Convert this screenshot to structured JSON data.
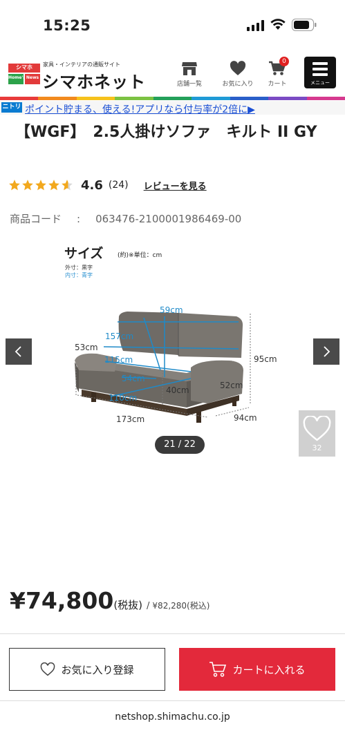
{
  "status": {
    "time": "15:25"
  },
  "header": {
    "logo_blocks": [
      "シマホ",
      "Home's",
      "News"
    ],
    "logo_tagline": "家具・インテリアの通販サイト",
    "logo_name": "シマホネット",
    "nav": [
      {
        "label": "店舗一覧",
        "icon": "store-icon"
      },
      {
        "label": "お気に入り",
        "icon": "heart-icon"
      },
      {
        "label": "カート",
        "icon": "cart-icon",
        "badge": "0"
      }
    ],
    "menu_label": "メニュー"
  },
  "colors": {
    "rainbow": [
      "#e83b3b",
      "#f28a1e",
      "#f6c21c",
      "#7cc242",
      "#24a05a",
      "#1f9ad6",
      "#2a5fc9",
      "#7b4bc4",
      "#d63a8f"
    ],
    "accent": "#e3293b",
    "link": "#1a4fd4",
    "dimension_blue": "#1f8ac8"
  },
  "promo": {
    "badge": "ニトリ",
    "text": "ポイント貯まる、使える!アプリなら付与率が2倍に▶"
  },
  "product": {
    "title": "【WGF】　2.5人掛けソファ　キルト II GY",
    "rating": {
      "score": "4.6",
      "count": "(24)",
      "stars": 4.6,
      "review_link": "レビューを見る"
    },
    "code_label": "商品コード",
    "code_sep": ":",
    "code_value": "063476-2100001986469-00"
  },
  "image": {
    "size_title": "サイズ",
    "size_unit": "(約)※単位：cm",
    "legend_outer": "外寸：黒字",
    "legend_inner": "内寸：青字",
    "dims_outer": [
      "53cm",
      "95cm",
      "52cm",
      "173cm",
      "94cm",
      "40cm"
    ],
    "dims_inner": [
      "59cm",
      "157cm",
      "115cm",
      "54cm",
      "110cm"
    ],
    "pager": "21 / 22",
    "fav_count": "32"
  },
  "price": {
    "main": "¥74,800",
    "tax_ex": "(税抜)",
    "slash": "/",
    "incl": "¥82,280(税込)"
  },
  "actions": {
    "favorite": "お気に入り登録",
    "cart": "カートに入れる"
  },
  "footer_url": "netshop.shimachu.co.jp"
}
